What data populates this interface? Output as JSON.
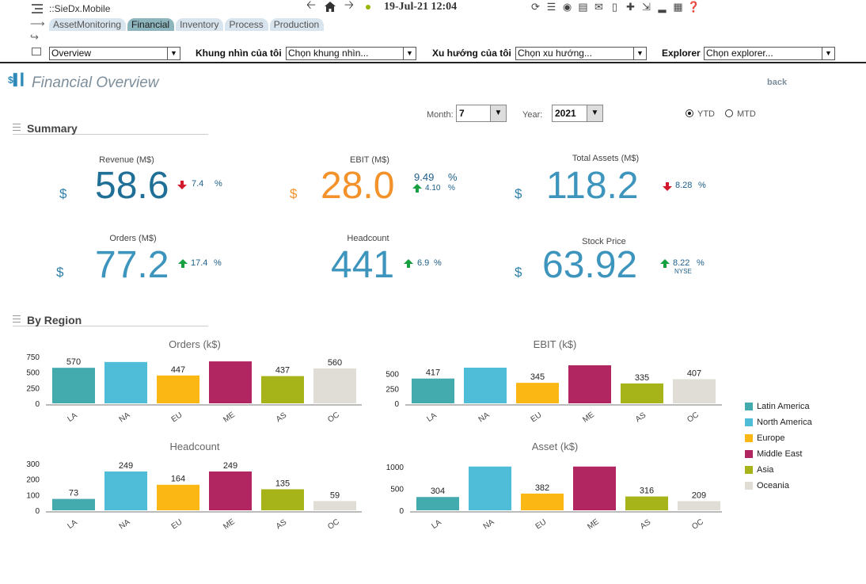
{
  "app": {
    "title": "::SieDx.Mobile",
    "datetime": "19-Jul-21 12:04"
  },
  "tabs": [
    "AssetMonitoring",
    "Financial",
    "Inventory",
    "Process",
    "Production"
  ],
  "active_tab": "Financial",
  "filters": {
    "view": "Overview",
    "my_view_label": "Khung nhìn của tôi",
    "my_view_value": "Chọn khung nhìn...",
    "my_trend_label": "Xu hướng của tôi",
    "my_trend_value": "Chọn xu hướng...",
    "explorer_label": "Explorer",
    "explorer_value": "Chọn explorer..."
  },
  "page": {
    "title": "Financial Overview",
    "back": "back"
  },
  "period": {
    "month_label": "Month:",
    "month": "7",
    "year_label": "Year:",
    "year": "2021",
    "ytd": "YTD",
    "mtd": "MTD",
    "selected": "YTD"
  },
  "summary": {
    "heading": "Summary",
    "revenue": {
      "label": "Revenue (M$)",
      "value": "58.6",
      "currency": "$",
      "change": "7.4",
      "unit": "%",
      "direction": "down"
    },
    "ebit": {
      "label": "EBIT (M$)",
      "value": "28.0",
      "currency": "$",
      "change1": "9.49",
      "change2": "4.10",
      "unit": "%",
      "direction": "up"
    },
    "total_assets": {
      "label": "Total Assets (M$)",
      "value": "118.2",
      "currency": "$",
      "change": "8.28",
      "unit": "%",
      "direction": "down"
    },
    "orders": {
      "label": "Orders (M$)",
      "value": "77.2",
      "currency": "$",
      "change": "17.4",
      "unit": "%",
      "direction": "up"
    },
    "headcount": {
      "label": "Headcount",
      "value": "441",
      "change": "6.9",
      "unit": "%",
      "direction": "up"
    },
    "stock_price": {
      "label": "Stock Price",
      "value": "63.92",
      "currency": "$",
      "change": "8.22",
      "unit": "%",
      "exchange": "NYSE",
      "direction": "up"
    }
  },
  "region": {
    "heading": "By Region",
    "legend": [
      "Latin America",
      "North America",
      "Europe",
      "Middle East",
      "Asia",
      "Oceania"
    ],
    "colors": [
      "#43aaad",
      "#4fbcd8",
      "#fbb714",
      "#b12561",
      "#a7b419",
      "#dfddd6"
    ]
  },
  "chart_data": [
    {
      "type": "bar",
      "title": "Orders (k$)",
      "categories": [
        "LA",
        "NA",
        "EU",
        "ME",
        "AS",
        "OC"
      ],
      "values": [
        570,
        663,
        447,
        673,
        437,
        560
      ],
      "data_labels": [
        "570",
        "",
        "447",
        "",
        "437",
        "560"
      ],
      "ylim": [
        0,
        750
      ],
      "yticks": [
        0,
        250,
        500,
        750
      ]
    },
    {
      "type": "bar",
      "title": "EBIT (k$)",
      "categories": [
        "LA",
        "NA",
        "EU",
        "ME",
        "AS",
        "OC"
      ],
      "values": [
        417,
        600,
        345,
        640,
        335,
        407
      ],
      "data_labels": [
        "417",
        "",
        "345",
        "",
        "335",
        "407"
      ],
      "ylim": [
        0,
        600
      ],
      "yticks": [
        0,
        250,
        500
      ]
    },
    {
      "type": "bar",
      "title": "Headcount",
      "categories": [
        "LA",
        "NA",
        "EU",
        "ME",
        "AS",
        "OC"
      ],
      "values": [
        73,
        249,
        164,
        249,
        135,
        59
      ],
      "data_labels": [
        "73",
        "249",
        "164",
        "249",
        "135",
        "59"
      ],
      "ylim": [
        0,
        300
      ],
      "yticks": [
        0,
        100,
        200,
        300
      ]
    },
    {
      "type": "bar",
      "title": "Asset (k$)",
      "categories": [
        "LA",
        "NA",
        "EU",
        "ME",
        "AS",
        "OC"
      ],
      "values": [
        304,
        1000,
        382,
        1000,
        316,
        209
      ],
      "data_labels": [
        "304",
        "",
        "382",
        "",
        "316",
        "209"
      ],
      "ylim": [
        0,
        1050
      ],
      "yticks": [
        0,
        500,
        1000
      ]
    }
  ]
}
